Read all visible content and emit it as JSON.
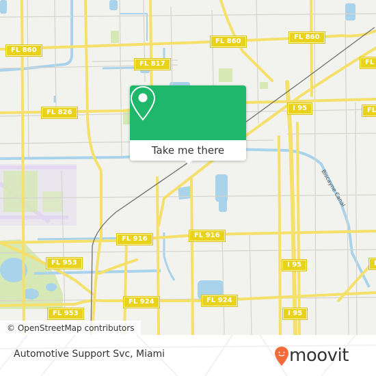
{
  "map": {
    "road_labels": [
      {
        "id": "fl860-west",
        "text": "FL 860"
      },
      {
        "id": "fl860-center",
        "text": "FL 860"
      },
      {
        "id": "fl860-east",
        "text": "FL 860"
      },
      {
        "id": "fl817",
        "text": "FL 817"
      },
      {
        "id": "fl826",
        "text": "FL 826"
      },
      {
        "id": "i95-north",
        "text": "I 95"
      },
      {
        "id": "fl-east-1",
        "text": "FL"
      },
      {
        "id": "fl-east-2",
        "text": "FL"
      },
      {
        "id": "fl916-west",
        "text": "FL 916"
      },
      {
        "id": "fl916-east",
        "text": "FL 916"
      },
      {
        "id": "fl953-north",
        "text": "FL 953"
      },
      {
        "id": "fl953-south",
        "text": "FL 953"
      },
      {
        "id": "fl924-west",
        "text": "FL 924"
      },
      {
        "id": "fl924-east",
        "text": "FL 924"
      },
      {
        "id": "i95-middle",
        "text": "I 95"
      },
      {
        "id": "i95-south",
        "text": "I 95"
      },
      {
        "id": "fl-east-3",
        "text": "FL"
      }
    ],
    "water_label": "Biscayne Canal",
    "attribution": "© OpenStreetMap contributors",
    "colors": {
      "background": "#f2f2ef",
      "road_major": "#f5e06a",
      "road_minor": "#d5d3cc",
      "water": "#a9d3ea",
      "park": "#d6e8b5",
      "airport": "#e6def0",
      "rail": "#777777"
    }
  },
  "popup": {
    "icon": "location-pin-icon",
    "button_label": "Take me there",
    "color": "#1fb86a"
  },
  "footer": {
    "title": "Automotive Support Svc, Miami",
    "brand": "moovit",
    "brand_color": "#f26b3a"
  }
}
